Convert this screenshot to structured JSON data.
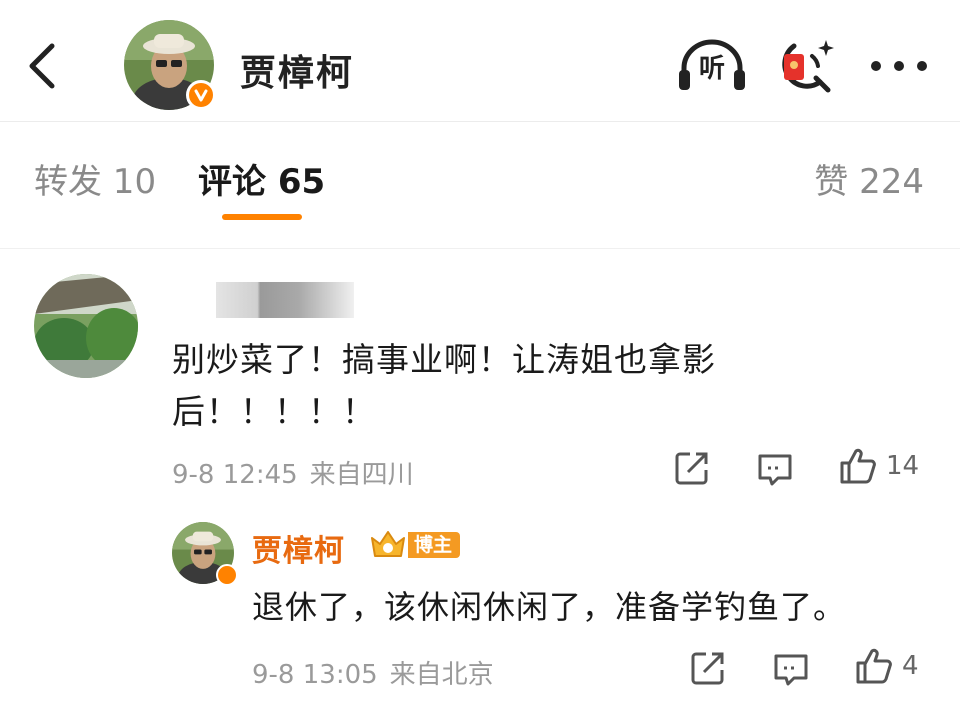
{
  "header": {
    "title": "贾樟柯",
    "listen_label": "听",
    "icons": {
      "back": "chevron-left-icon",
      "verified": "verified-badge-icon",
      "listen": "headphones-icon",
      "red_packet": "red-packet-search-icon",
      "more": "more-dots-icon"
    }
  },
  "tabs": {
    "repost": "转发 10",
    "comment": "评论 65",
    "like": "赞 224"
  },
  "comment": {
    "text": "别炒菜了！搞事业啊！让涛姐也拿影后！！！！！",
    "time": "9-8 12:45",
    "location": "来自四川",
    "like_count": "14",
    "reply": {
      "username": "贾樟柯",
      "badge": "博主",
      "text": "退休了，该休闲休闲了，准备学钓鱼了。",
      "time": "9-8 13:05",
      "location": "来自北京",
      "like_count": "4"
    }
  },
  "colors": {
    "accent": "#ff8200",
    "username": "#e86a10",
    "muted": "#9a9a9a"
  }
}
